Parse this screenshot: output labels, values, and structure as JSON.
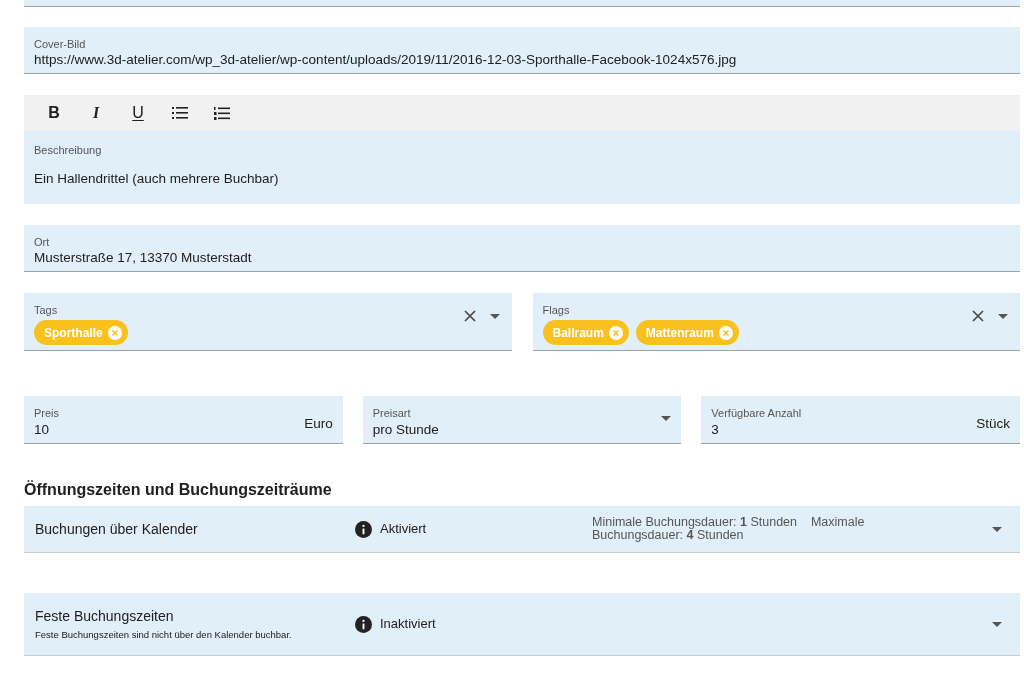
{
  "cover": {
    "label": "Cover-Bild",
    "value": "https://www.3d-atelier.com/wp_3d-atelier/wp-content/uploads/2019/11/2016-12-03-Sporthalle-Facebook-1024x576.jpg"
  },
  "editor": {
    "toolbar": [
      {
        "kind": "bold",
        "label": "B"
      },
      {
        "kind": "italic",
        "label": "I"
      },
      {
        "kind": "underline",
        "label": "U"
      },
      {
        "kind": "bullet-list"
      },
      {
        "kind": "numbered-list"
      }
    ],
    "label": "Beschreibung",
    "value": "Ein Hallendrittel (auch mehrere Buchbar)"
  },
  "location": {
    "label": "Ort",
    "value": "Musterstraße 17, 13370 Musterstadt"
  },
  "chip_fields": [
    {
      "label": "Tags",
      "chips": [
        "Sporthalle"
      ]
    },
    {
      "label": "Flags",
      "chips": [
        "Ballraum",
        "Mattenraum"
      ]
    }
  ],
  "fields": [
    {
      "kind": "text",
      "label": "Preis",
      "value": "10",
      "suffix": "Euro"
    },
    {
      "kind": "select",
      "label": "Preisart",
      "value": "pro Stunde"
    },
    {
      "kind": "text",
      "label": "Verfügbare Anzahl",
      "value": "3",
      "suffix": "Stück"
    }
  ],
  "section_title": "Öffnungszeiten und Buchungszeiträume",
  "panels": [
    {
      "title": "Buchungen über Kalender",
      "status": "Aktiviert",
      "details": "Minimale Buchungsdauer: **1** Stunden    Maximale Buchungsdauer: **4** Stunden"
    },
    {
      "title": "Feste Buchungszeiten",
      "subtitle": "Feste Buchungszeiten sind nicht über den Kalender buchbar.",
      "status": "Inaktiviert"
    }
  ]
}
